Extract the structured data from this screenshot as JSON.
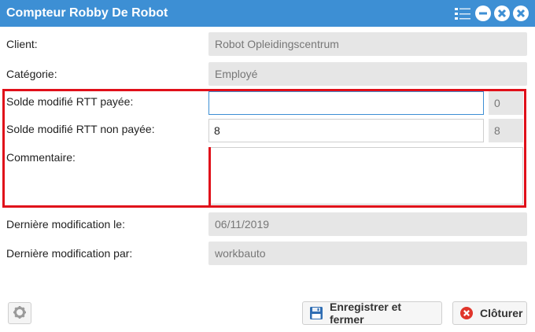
{
  "window": {
    "title": "Compteur Robby De Robot",
    "accent": "#3d8fd4",
    "highlight": "#e0101a"
  },
  "fields": {
    "client": {
      "label": "Client:",
      "value": "Robot Opleidingscentrum"
    },
    "categorie": {
      "label": "Catégorie:",
      "value": "Employé"
    },
    "rtt_payee": {
      "label": "Solde modifié RTT payée:",
      "value": "",
      "counter": "0"
    },
    "rtt_non_payee": {
      "label": "Solde modifié RTT non payée:",
      "value": "8",
      "counter": "8"
    },
    "commentaire": {
      "label": "Commentaire:",
      "value": ""
    },
    "derniere_modif_le": {
      "label": "Dernière modification le:",
      "value": "06/11/2019"
    },
    "derniere_modif_par": {
      "label": "Dernière modification par:",
      "value": "workbauto"
    }
  },
  "footer": {
    "save_label": "Enregistrer et fermer",
    "close_label": "Clôturer"
  },
  "icons": {
    "titlebar": [
      "menu-icon",
      "minimize-icon",
      "restore-icon",
      "close-icon"
    ],
    "settings": "gear-icon",
    "save": "floppy-disk-icon",
    "close": "cancel-circle-icon"
  }
}
